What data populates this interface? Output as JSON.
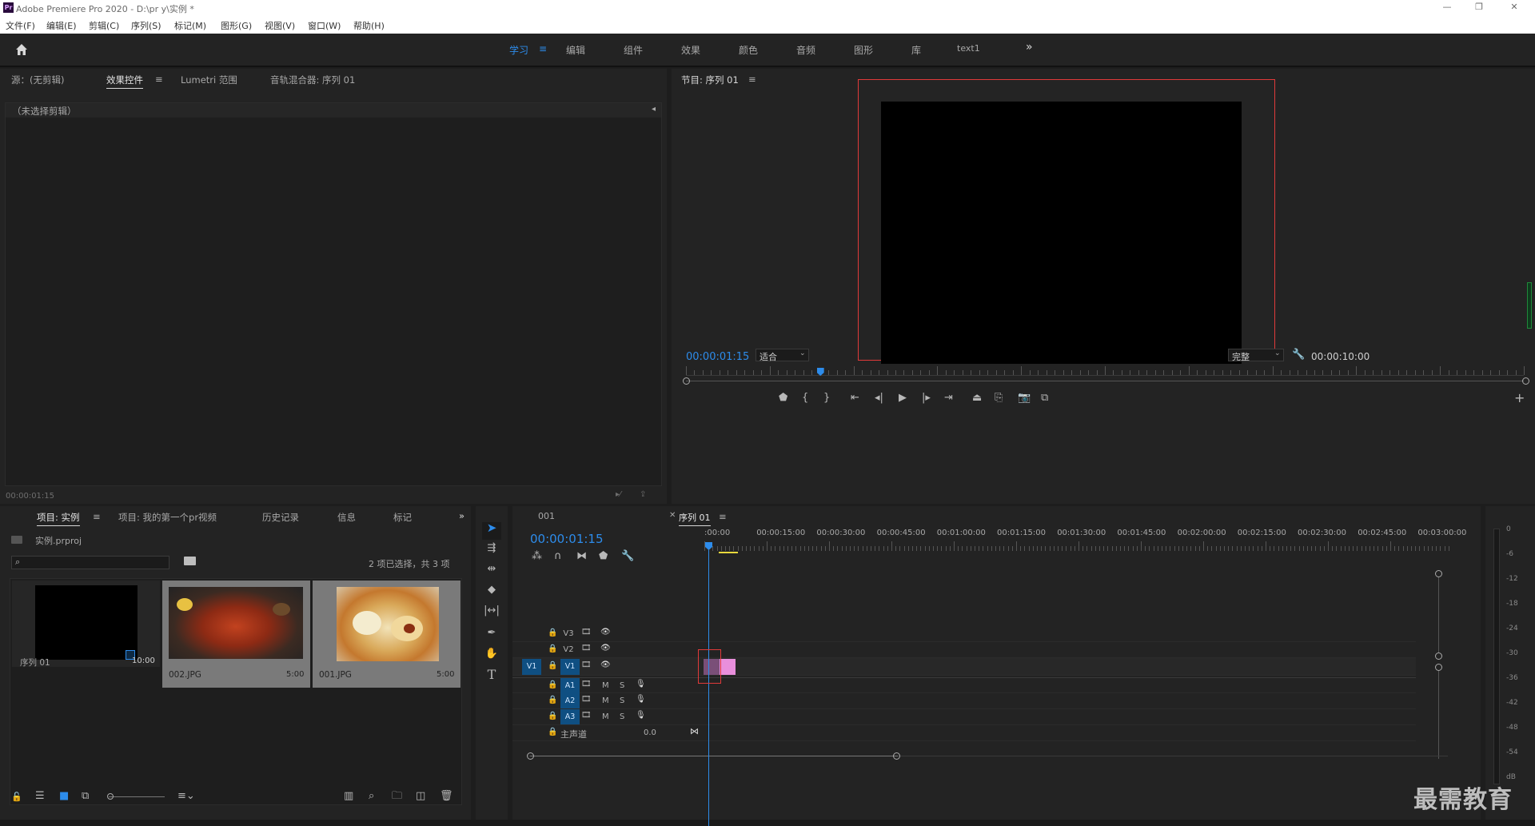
{
  "app": {
    "title": "Adobe Premiere Pro 2020 - D:\\pr y\\实例 *",
    "window_controls": {
      "minimize": "—",
      "restore": "❐",
      "close": "✕"
    }
  },
  "menu": [
    "文件(F)",
    "编辑(E)",
    "剪辑(C)",
    "序列(S)",
    "标记(M)",
    "图形(G)",
    "视图(V)",
    "窗口(W)",
    "帮助(H)"
  ],
  "workspaces": {
    "tabs": [
      "学习",
      "编辑",
      "组件",
      "效果",
      "颜色",
      "音频",
      "图形",
      "库",
      "text1"
    ],
    "active": "学习",
    "more": "»"
  },
  "source_panel": {
    "tabs": [
      "源：(无剪辑)",
      "效果控件",
      "Lumetri 范围",
      "音轨混合器: 序列 01"
    ],
    "active_tab": "效果控件",
    "no_clip_text": "（未选择剪辑）",
    "timecode": "00:00:01:15"
  },
  "program_monitor": {
    "tab": "节目: 序列 01",
    "timecode": "00:00:01:15",
    "fit_select": "适合",
    "quality_select": "完整",
    "duration": "00:00:10:00",
    "playhead_fraction": 0.16
  },
  "project_panel": {
    "tabs": [
      "项目: 实例",
      "项目: 我的第一个pr视频",
      "历史记录",
      "信息",
      "标记"
    ],
    "active_tab": "项目: 实例",
    "project_file": "实例.prproj",
    "search_placeholder": "",
    "selection_status": "2 项已选择，共 3 项",
    "items": [
      {
        "name": "序列 01",
        "duration": "10:00",
        "kind": "sequence",
        "selected": false
      },
      {
        "name": "002.JPG",
        "duration": "5:00",
        "kind": "image",
        "selected": true
      },
      {
        "name": "001.JPG",
        "duration": "5:00",
        "kind": "image",
        "selected": true
      }
    ]
  },
  "tools": [
    "selection-tool",
    "track-select-tool",
    "ripple-edit-tool",
    "razor-tool",
    "slip-tool",
    "pen-tool",
    "hand-tool",
    "type-tool"
  ],
  "timeline": {
    "tabs": [
      "001",
      "序列 01"
    ],
    "active_tab": "序列 01",
    "timecode": "00:00:01:15",
    "ruler_labels": [
      ":00:00",
      "00:00:15:00",
      "00:00:30:00",
      "00:00:45:00",
      "00:01:00:00",
      "00:01:15:00",
      "00:01:30:00",
      "00:01:45:00",
      "00:02:00:00",
      "00:02:15:00",
      "00:02:30:00",
      "00:02:45:00",
      "00:03:00:00"
    ],
    "video_tracks": [
      "V3",
      "V2",
      "V1"
    ],
    "source_patch_video": "V1",
    "audio_tracks": [
      "A1",
      "A2",
      "A3"
    ],
    "audio_buttons": {
      "mute": "M",
      "solo": "S"
    },
    "master": {
      "label": "主声道",
      "value": "0.0"
    }
  },
  "audio_meter": {
    "scale": [
      "0",
      "-6",
      "-12",
      "-18",
      "-24",
      "-30",
      "-36",
      "-42",
      "-48",
      "-54",
      "dB"
    ]
  },
  "watermark": "最需教育",
  "colors": {
    "accent_blue": "#2d8ceb",
    "highlight_red": "#e03a3a",
    "clip_pink": "#e98fdc",
    "panel_bg": "#232323",
    "target_blue": "#0f4f82"
  }
}
